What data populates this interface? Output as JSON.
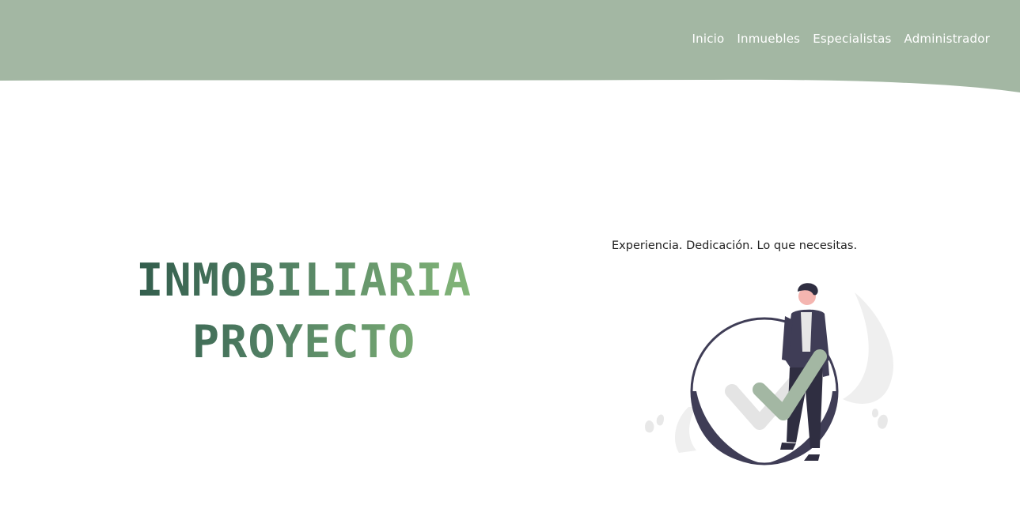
{
  "header": {
    "background_color": "#a3b7a3",
    "nav": [
      {
        "label": "Inicio"
      },
      {
        "label": "Inmuebles"
      },
      {
        "label": "Especialistas"
      },
      {
        "label": "Administrador"
      }
    ]
  },
  "hero": {
    "title_line1": "INMOBILIARIA",
    "title_line2": "PROYECTO",
    "title_gradient": [
      "#2e5849",
      "#8cc07c"
    ],
    "tagline": "Experiencia. Dedicación. Lo que necesitas.",
    "illustration": "person-with-checkmark-illustration",
    "accent_color": "#a3b7a3"
  }
}
